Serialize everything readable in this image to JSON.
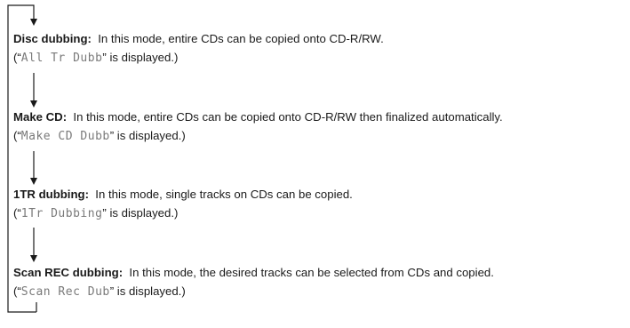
{
  "modes": [
    {
      "name": "Disc dubbing:",
      "description": "In this mode, entire CDs can be copied onto CD-R/RW.",
      "open": "(“",
      "display": "All Tr Dubb",
      "close": "” is displayed.)"
    },
    {
      "name": "Make CD:",
      "description": "In this mode, entire CDs can be copied onto CD-R/RW then finalized automatically.",
      "open": "(“",
      "display": "Make CD Dubb",
      "close": "” is displayed.)"
    },
    {
      "name": "1TR dubbing:",
      "description": "In this mode, single tracks on CDs can be copied.",
      "open": "(“",
      "display": "1Tr Dubbing",
      "close": "” is displayed.)"
    },
    {
      "name": "Scan REC dubbing:",
      "description": "In this mode, the desired tracks can be selected from CDs and copied.",
      "open": "(“",
      "display": "Scan Rec Dub",
      "close": "” is displayed.)"
    }
  ]
}
